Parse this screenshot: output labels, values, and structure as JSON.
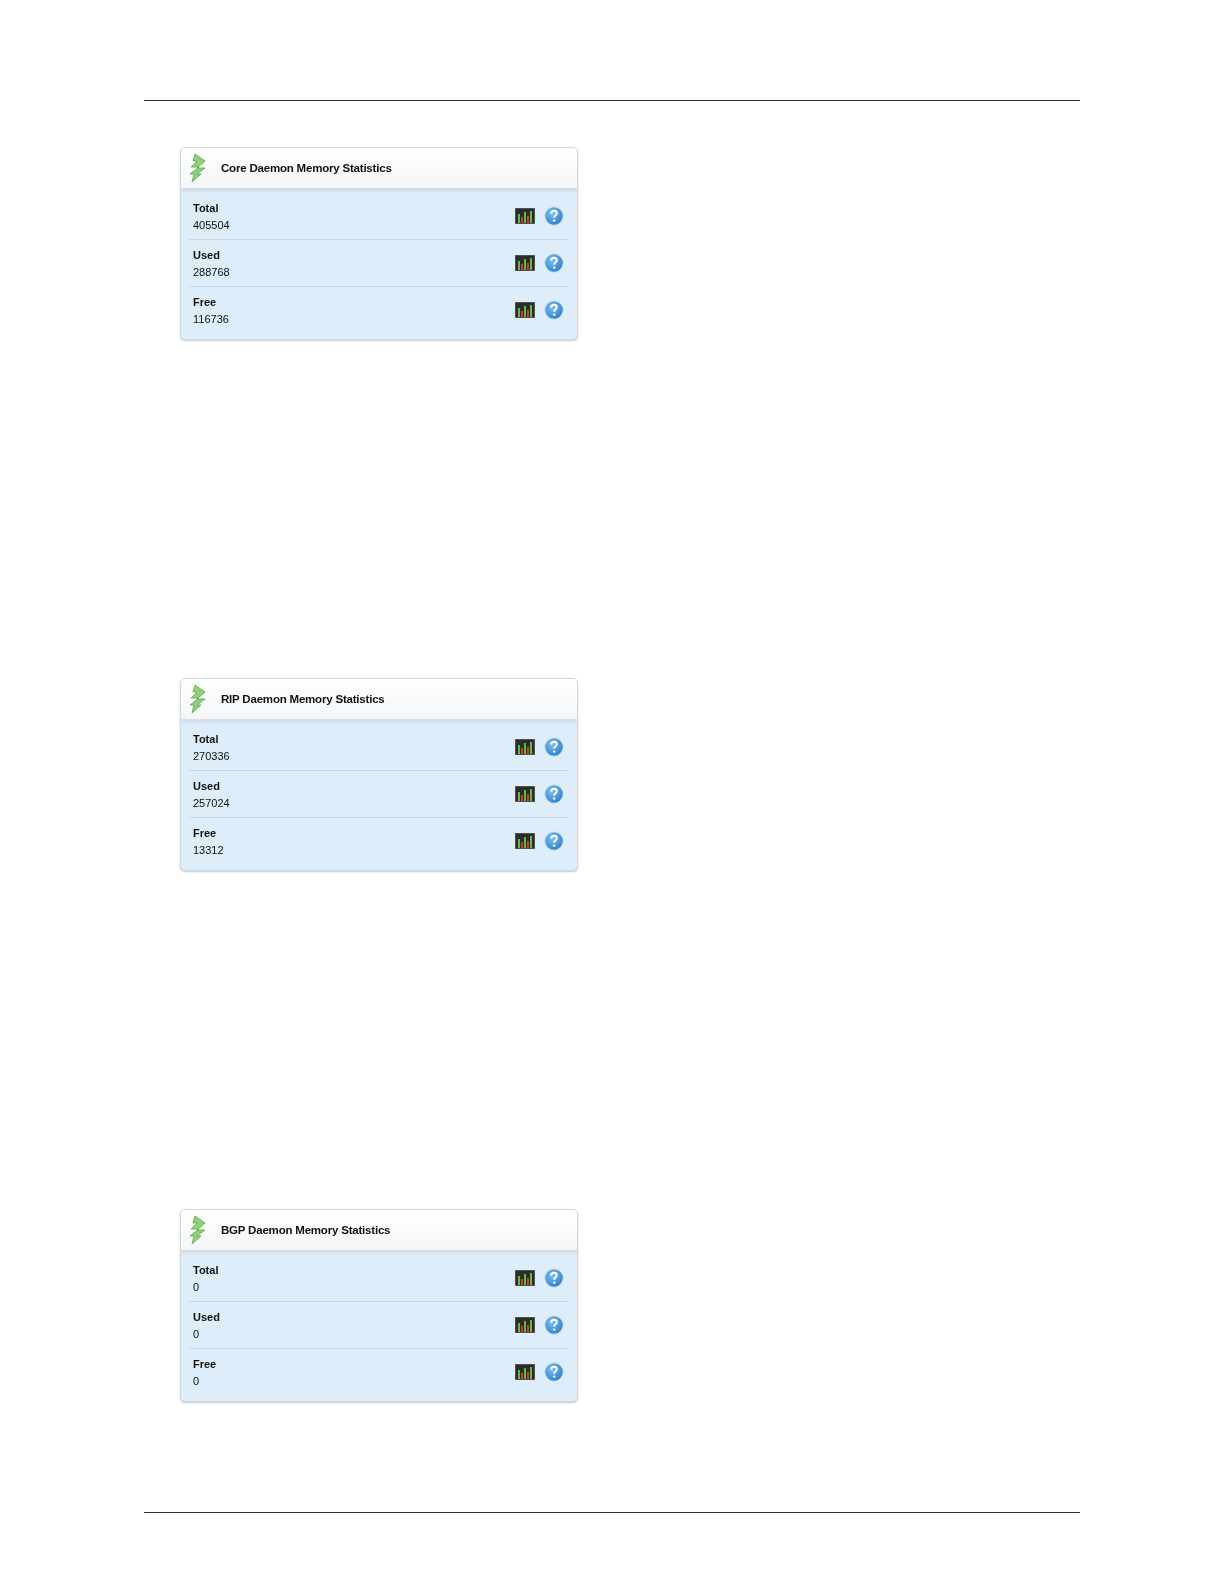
{
  "panels": [
    {
      "title": "Core Daemon Memory Statistics",
      "rows": [
        {
          "label": "Total",
          "value": "405504"
        },
        {
          "label": "Used",
          "value": "288768"
        },
        {
          "label": "Free",
          "value": "116736"
        }
      ]
    },
    {
      "title": "RIP Daemon Memory Statistics",
      "rows": [
        {
          "label": "Total",
          "value": "270336"
        },
        {
          "label": "Used",
          "value": "257024"
        },
        {
          "label": "Free",
          "value": "13312"
        }
      ]
    },
    {
      "title": "BGP Daemon Memory Statistics",
      "rows": [
        {
          "label": "Total",
          "value": "0"
        },
        {
          "label": "Used",
          "value": "0"
        },
        {
          "label": "Free",
          "value": "0"
        }
      ]
    }
  ]
}
